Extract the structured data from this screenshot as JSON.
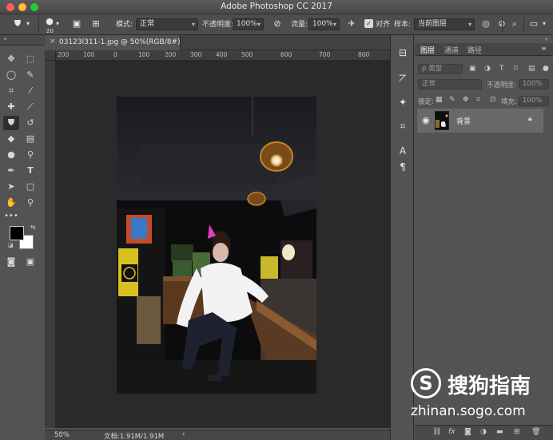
{
  "window": {
    "title": "Adobe Photoshop CC 2017"
  },
  "options_bar": {
    "brush_size": "20",
    "mode_label": "模式:",
    "mode_value": "正常",
    "opacity_label": "不透明度:",
    "opacity_value": "100%",
    "flow_label": "流量:",
    "flow_value": "100%",
    "aligned_label": "对齐",
    "sample_label": "样本:",
    "sample_value": "当前图层"
  },
  "document": {
    "tab_title": "03123l311-1.jpg @ 50%(RGB/8#)",
    "ruler_ticks": [
      "200",
      "100",
      "0",
      "100",
      "200",
      "300",
      "400",
      "500",
      "600",
      "700",
      "800"
    ]
  },
  "status_bar": {
    "zoom": "50%",
    "doc_info": "文档:1.91M/1.91M"
  },
  "layers_panel": {
    "tabs": [
      "图层",
      "通道",
      "路径"
    ],
    "filter_placeholder": "ρ 类型",
    "blend_mode": "正常",
    "opacity_label": "不透明度:",
    "opacity_value": "100%",
    "lock_label": "锁定:",
    "fill_label": "填充:",
    "fill_value": "100%",
    "layers": [
      {
        "name": "背景",
        "visible": true,
        "locked": true
      }
    ],
    "bottom_icons": [
      "link-icon",
      "fx-icon",
      "mask-icon",
      "adjustment-icon",
      "folder-icon",
      "new-layer-icon",
      "trash-icon"
    ],
    "fx_label": "fx"
  },
  "watermark": {
    "logo_letter": "S",
    "text_cn": "搜狗指南",
    "url": "zhinan.sogo.com"
  },
  "colors": {
    "foreground": "#000000",
    "background": "#ffffff",
    "ui_dark": "#535353",
    "canvas_bg": "#2a2a2a"
  }
}
